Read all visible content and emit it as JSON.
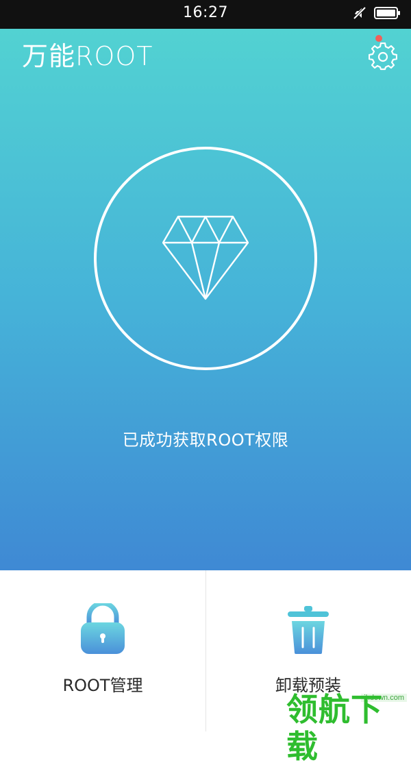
{
  "status_bar": {
    "time": "16:27",
    "icons": [
      "mute-icon",
      "battery-icon"
    ]
  },
  "header": {
    "title": "万能ROOT",
    "settings_icon": "gear-icon",
    "notification_dot_color": "#f0605a"
  },
  "main": {
    "status_icon": "diamond-icon",
    "status_message": "已成功获取ROOT权限"
  },
  "actions": [
    {
      "label": "ROOT管理",
      "icon": "lock-icon"
    },
    {
      "label": "卸载预装",
      "icon": "trash-icon"
    }
  ],
  "watermark": {
    "site": "ihdown.com",
    "text": "领航下载"
  },
  "colors": {
    "gradient_top": "#52d2d2",
    "gradient_bottom": "#3f89d4",
    "accent_icon_top": "#6cd6e0",
    "accent_icon_bottom": "#4a90d9"
  }
}
